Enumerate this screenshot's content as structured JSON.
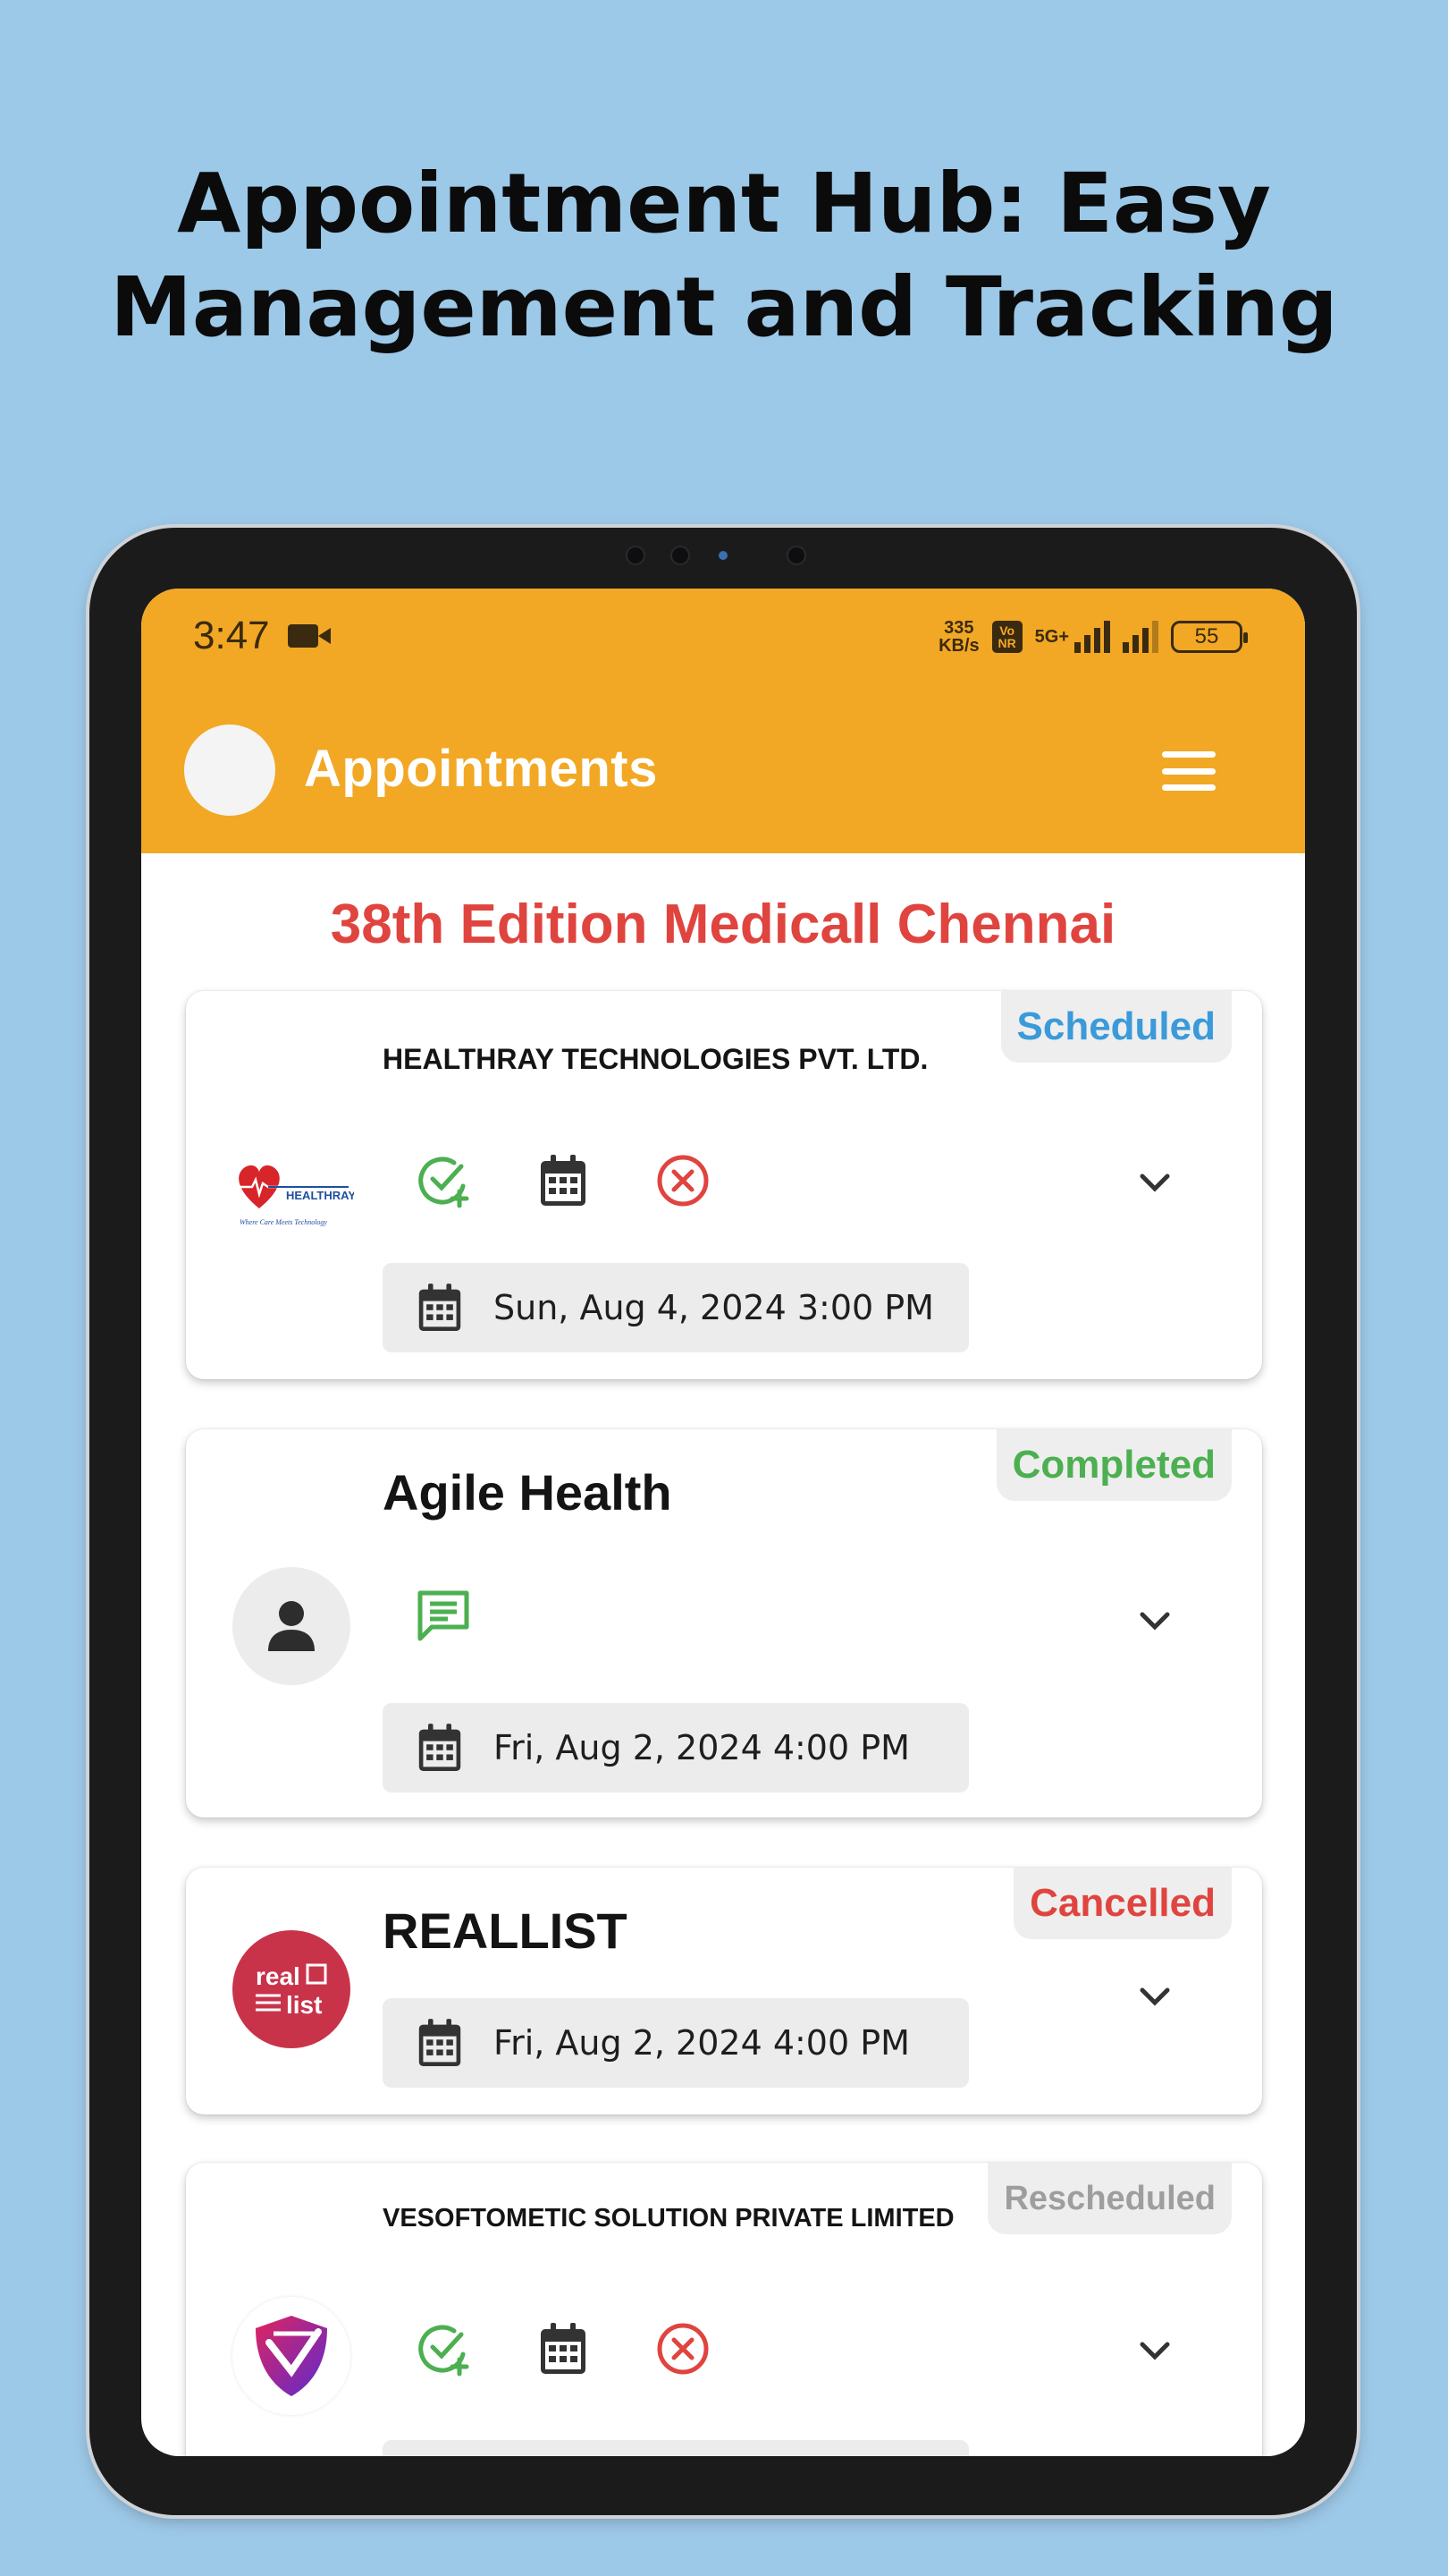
{
  "headline": {
    "line1": "Appointment Hub: Easy",
    "line2": "Management and Tracking"
  },
  "status_bar": {
    "time": "3:47",
    "speed_value": "335",
    "speed_unit": "KB/s",
    "vonr": "Vo NR",
    "network": "5G+",
    "battery": "55"
  },
  "app_bar": {
    "title": "Appointments",
    "menu_icon": "hamburger-menu-icon"
  },
  "event_title": "38th Edition  Medicall Chennai",
  "appointments": [
    {
      "company": "HEALTHRAY TECHNOLOGIES PVT. LTD.",
      "status": "Scheduled",
      "status_color": "#3b9ad9",
      "logo_text": "HEALTHRAY",
      "logo_tagline": "Where Care Meets Technology",
      "actions": [
        "check-add-icon",
        "calendar-icon",
        "cancel-icon"
      ],
      "datetime": "Sun, Aug 4, 2024 3:00 PM"
    },
    {
      "company": "Agile Health",
      "status": "Completed",
      "status_color": "#4caf50",
      "actions": [
        "message-icon"
      ],
      "datetime": "Fri, Aug 2, 2024 4:00 PM"
    },
    {
      "company": "REALLIST",
      "status": "Cancelled",
      "status_color": "#e0443f",
      "logo_text_1": "real",
      "logo_text_2": "list",
      "datetime": "Fri, Aug 2, 2024 4:00 PM"
    },
    {
      "company": "VESOFTOMETIC SOLUTION PRIVATE LIMITED",
      "status": "Rescheduled",
      "status_color": "#9e9e9e",
      "actions": [
        "check-add-icon",
        "calendar-icon",
        "cancel-icon"
      ]
    }
  ],
  "colors": {
    "background": "#9dc9e8",
    "app_bar": "#f2a824",
    "event_title": "#e0443f",
    "action_green": "#4caf50",
    "action_red": "#e0443f"
  }
}
